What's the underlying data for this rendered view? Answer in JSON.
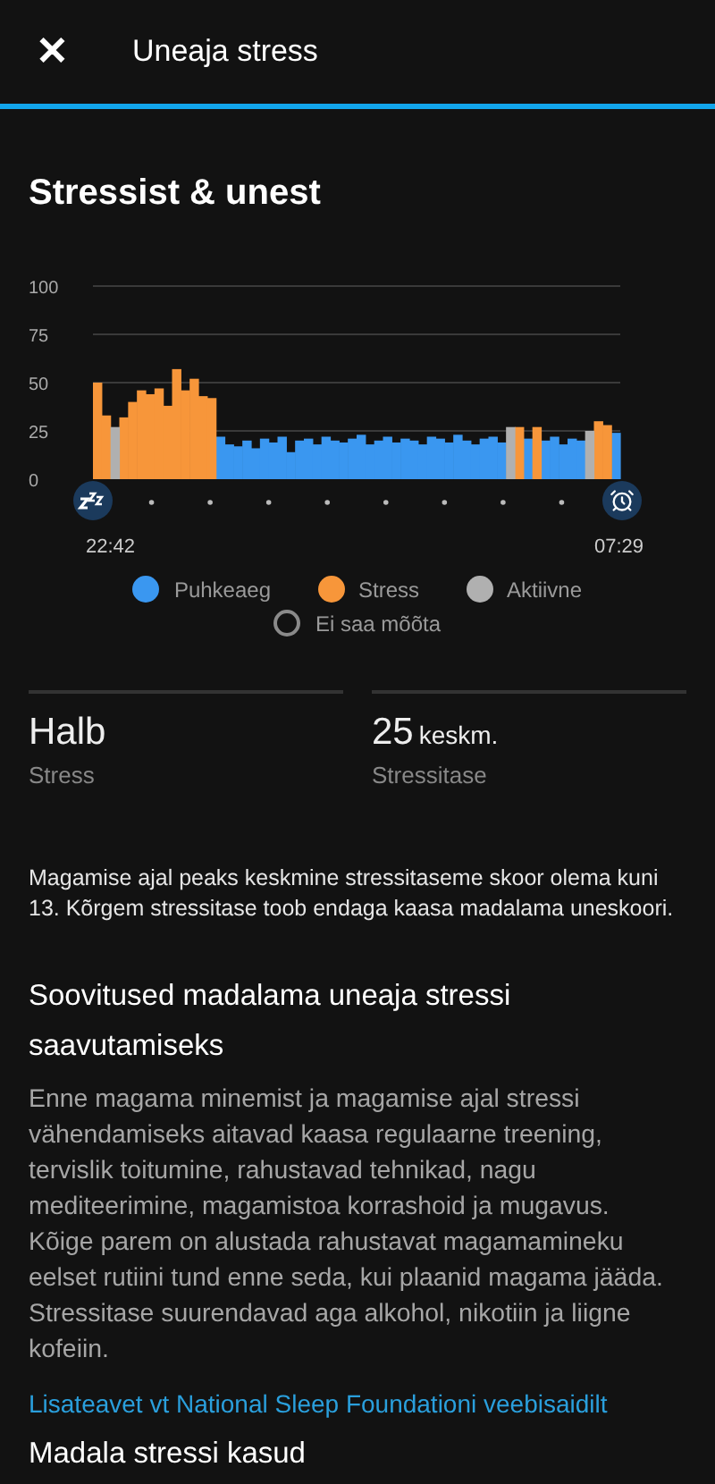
{
  "header": {
    "close": "✕",
    "title": "Uneaja stress"
  },
  "section_title": "Stressist & unest",
  "chart": {
    "start_time": "22:42",
    "end_time": "07:29",
    "chart_data": {
      "type": "bar",
      "stacked": true,
      "grid": true,
      "ylim": [
        0,
        100
      ],
      "yticks": [
        0,
        25,
        50,
        75,
        100
      ],
      "series": [
        {
          "name": "Puhkeaeg",
          "color": "#3a97f0",
          "values": [
            null,
            null,
            null,
            null,
            null,
            null,
            null,
            null,
            null,
            null,
            null,
            null,
            null,
            null,
            22,
            18,
            17,
            20,
            16,
            21,
            19,
            22,
            14,
            20,
            21,
            18,
            22,
            20,
            19,
            21,
            23,
            18,
            20,
            22,
            19,
            21,
            20,
            18,
            22,
            21,
            19,
            23,
            20,
            18,
            21,
            22,
            19,
            null,
            null,
            21,
            null,
            20,
            22,
            18,
            21,
            20,
            null,
            null,
            null,
            24
          ]
        },
        {
          "name": "Stress",
          "color": "#f7963a",
          "values": [
            50,
            33,
            null,
            32,
            40,
            46,
            44,
            47,
            38,
            57,
            46,
            52,
            43,
            42,
            null,
            null,
            null,
            null,
            null,
            null,
            null,
            null,
            null,
            null,
            null,
            null,
            null,
            null,
            null,
            null,
            null,
            null,
            null,
            null,
            null,
            null,
            null,
            null,
            null,
            null,
            null,
            null,
            null,
            null,
            null,
            null,
            null,
            null,
            27,
            null,
            27,
            null,
            null,
            null,
            null,
            null,
            null,
            30,
            28,
            null
          ]
        },
        {
          "name": "Aktiivne",
          "color": "#b0b0b0",
          "values": [
            null,
            null,
            27,
            null,
            null,
            null,
            null,
            null,
            null,
            null,
            null,
            null,
            null,
            null,
            null,
            null,
            null,
            null,
            null,
            null,
            null,
            null,
            null,
            null,
            null,
            null,
            null,
            null,
            null,
            null,
            null,
            null,
            null,
            null,
            null,
            null,
            null,
            null,
            null,
            null,
            null,
            null,
            null,
            null,
            null,
            null,
            null,
            27,
            null,
            null,
            null,
            null,
            null,
            null,
            null,
            null,
            25,
            null,
            null,
            null
          ]
        }
      ]
    }
  },
  "unmeasured": {
    "label": "Ei saa mõõta",
    "color": "#8a8a8a"
  },
  "stats": [
    {
      "value": "Halb",
      "label": "Stress"
    },
    {
      "value": "25",
      "unit": "keskm.",
      "label": "Stressitase"
    }
  ],
  "note": "Magamise ajal peaks keskmine stressitaseme skoor olema kuni 13. Kõrgem stressitase toob endaga kaasa madalama uneskoori.",
  "tips": {
    "title": "Soovitused madalama uneaja stressi saavutamiseks",
    "body": "Enne magama minemist ja magamise ajal stressi vähendamiseks aitavad kaasa regulaarne treening, tervislik toitumine, rahustavad tehnikad, nagu mediteerimine, magamistoa korrashoid ja mugavus. Kõige parem on alustada rahustavat magamamineku eelset rutiini tund enne seda, kui plaanid magama jääda. Stressitase suurendavad aga alkohol, nikotiin ja liigne kofeiin.",
    "link": "Lisateavet vt National Sleep Foundationi veebisaidilt"
  },
  "next_title": "Madala stressi kasud"
}
